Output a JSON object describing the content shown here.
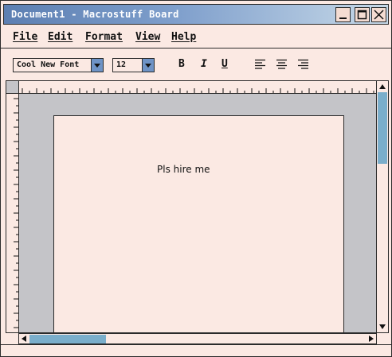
{
  "window": {
    "title": "Document1 - Macrostuff Board"
  },
  "menu": [
    "File",
    "Edit",
    "Format",
    "View",
    "Help"
  ],
  "toolbar": {
    "font": "Cool New Font",
    "size": "12",
    "bold_label": "B",
    "italic_label": "I",
    "underline_label": "U"
  },
  "document": {
    "text": "Pls hire me"
  },
  "colors": {
    "titlebar_start": "#5c7fb2",
    "titlebar_end": "#c7d9e8",
    "background": "#fbe9e3",
    "scroll_thumb": "#7aaecb"
  }
}
